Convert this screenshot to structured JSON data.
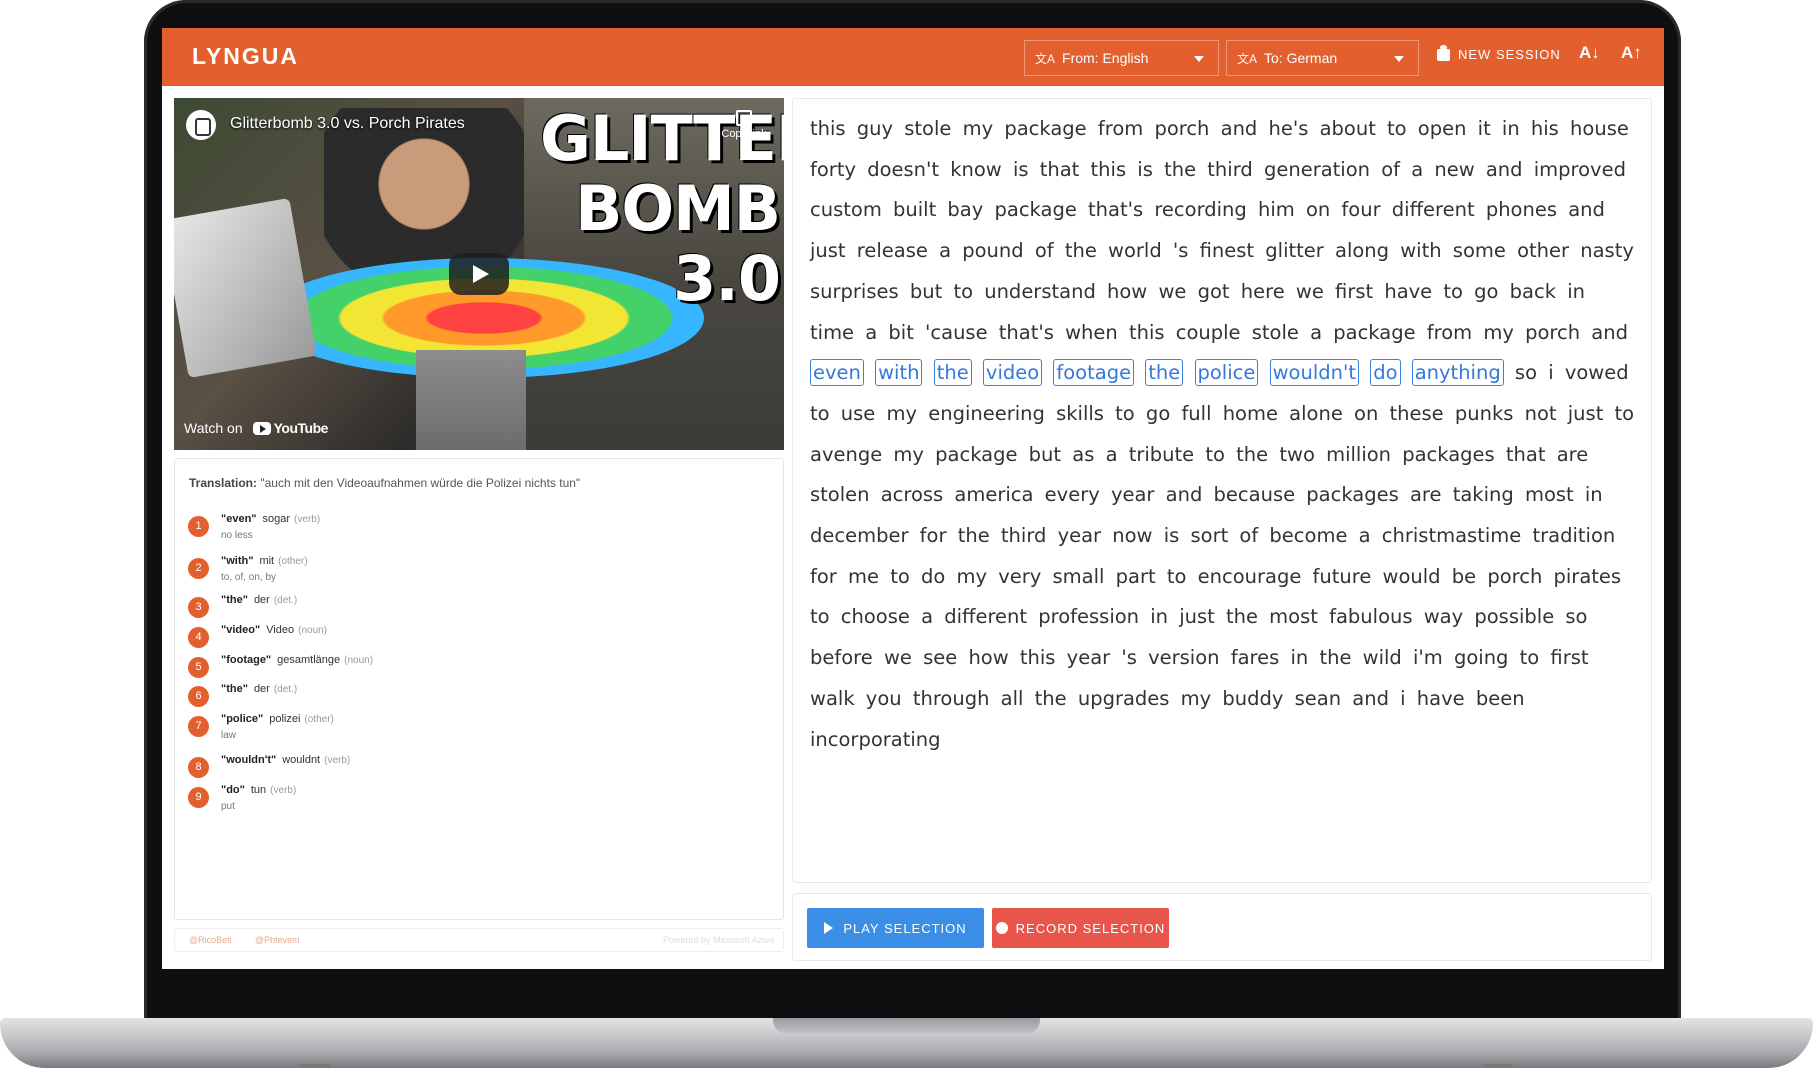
{
  "app": {
    "brand": "LYNGUA"
  },
  "header": {
    "from_label": "From: English",
    "to_label": "To: German",
    "new_session": "NEW SESSION",
    "font_decrease": "A↓",
    "font_increase": "A↑"
  },
  "video": {
    "title": "Glitterbomb 3.0 vs. Porch Pirates",
    "thumbnail_text": [
      "GLITTER",
      "BOMB",
      "3.0"
    ],
    "copy_link": "Copy link",
    "watch_on": "Watch on",
    "youtube": "YouTube"
  },
  "translation": {
    "label": "Translation:",
    "text": "\"auch mit den Videoaufnahmen würde die Polizei nichts tun\"",
    "words": [
      {
        "num": "1",
        "src": "\"even\"",
        "tgt": "sogar",
        "pos": "(verb)",
        "alt": "no less"
      },
      {
        "num": "2",
        "src": "\"with\"",
        "tgt": "mit",
        "pos": "(other)",
        "alt": "to, of, on, by"
      },
      {
        "num": "3",
        "src": "\"the\"",
        "tgt": "der",
        "pos": "(det.)",
        "alt": ""
      },
      {
        "num": "4",
        "src": "\"video\"",
        "tgt": "Video",
        "pos": "(noun)",
        "alt": ""
      },
      {
        "num": "5",
        "src": "\"footage\"",
        "tgt": "gesamtlänge",
        "pos": "(noun)",
        "alt": ""
      },
      {
        "num": "6",
        "src": "\"the\"",
        "tgt": "der",
        "pos": "(det.)",
        "alt": ""
      },
      {
        "num": "7",
        "src": "\"police\"",
        "tgt": "polizei",
        "pos": "(other)",
        "alt": "law"
      },
      {
        "num": "8",
        "src": "\"wouldn't\"",
        "tgt": "wouldnt",
        "pos": "(verb)",
        "alt": ""
      },
      {
        "num": "9",
        "src": "\"do\"",
        "tgt": "tun",
        "pos": "(verb)",
        "alt": "put"
      }
    ]
  },
  "footer": {
    "credit1": "@RicoBeti",
    "credit2": "@Phtevem",
    "powered": "Powered by Microsoft Azure"
  },
  "transcript": {
    "before": "this guy stole my package from porch and he's about to open it in his house forty doesn't know is that this is the third generation of a new and improved custom built bay package that's recording him on four different phones and just release a pound of the world 's finest glitter along with some other nasty surprises but to understand how we got here we first have to go back in time a bit 'cause that's when this couple stole a package from my porch and",
    "selected": [
      "even",
      "with",
      "the",
      "video",
      "footage",
      "the",
      "police",
      "wouldn't",
      "do",
      "anything"
    ],
    "after": "so i vowed to use my engineering skills to go full home alone on these punks not just to avenge my package but as a tribute to the two million packages that are stolen across america every year and because packages are taking most in december for the third year now is sort of become a christmastime tradition for me to do my very small part to encourage future would be porch pirates to choose a different profession in just the most fabulous way possible so before we see how this year 's version fares in the wild i'm going to first walk you through all the upgrades my buddy sean and i have been incorporating"
  },
  "actions": {
    "play": "PLAY SELECTION",
    "record": "RECORD SELECTION"
  }
}
